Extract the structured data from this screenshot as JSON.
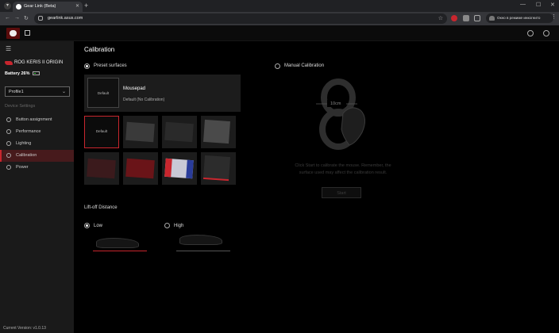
{
  "browser": {
    "tab_title": "Gear Link (Beta)",
    "url": "gearlink.asus.com",
    "incognito_label": "Окно в режиме инкогнито",
    "new_tab": "+"
  },
  "sidebar": {
    "device_name": "ROG KERIS II ORIGIN",
    "battery": "Battery 26%",
    "battery_level": 0.26,
    "profile": "Profile1",
    "section_label": "Device Settings",
    "items": [
      {
        "label": "Button assignment",
        "icon": "mouse-button-icon"
      },
      {
        "label": "Performance",
        "icon": "gauge-icon"
      },
      {
        "label": "Lighting",
        "icon": "bulb-icon"
      },
      {
        "label": "Calibration",
        "icon": "calibration-icon"
      },
      {
        "label": "Power",
        "icon": "power-icon"
      }
    ],
    "active_item": "Calibration",
    "version": "Current Version: v1.0.13"
  },
  "main": {
    "title": "Calibration",
    "preset_label": "Preset surfaces",
    "manual_label": "Manual Calibration",
    "selected_pad": {
      "thumb_label": "Default",
      "name": "Mousepad",
      "description": "Default (No Calibration)"
    },
    "grid_default_label": "Default",
    "liftoff": {
      "title": "Lift-off Distance",
      "low": "Low",
      "high": "High",
      "selected": "Low"
    },
    "manual": {
      "distance_label": "10cm",
      "instructions_line1": "Click Start to calibrate the mouse. Remember, the",
      "instructions_line2": "surface used may affect the calibration result.",
      "start_label": "Start"
    }
  },
  "colors": {
    "accent": "#c8262e",
    "background": "#000000",
    "sidebar": "#1a1a1a"
  }
}
